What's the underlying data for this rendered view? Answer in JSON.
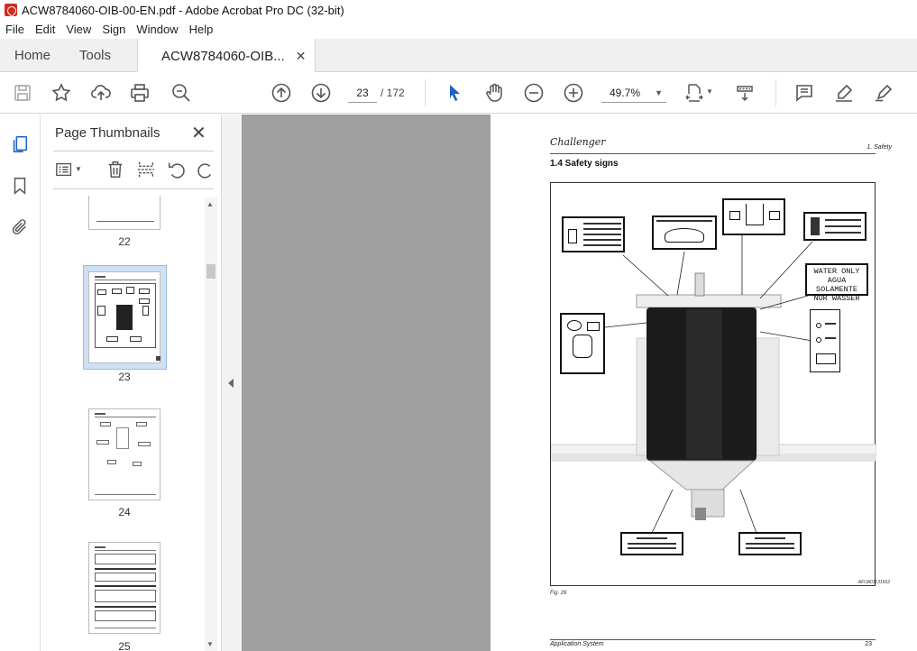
{
  "window": {
    "title": "ACW8784060-OIB-00-EN.pdf - Adobe Acrobat Pro DC (32-bit)"
  },
  "menu": [
    "File",
    "Edit",
    "View",
    "Sign",
    "Window",
    "Help"
  ],
  "tabs": {
    "home": "Home",
    "tools": "Tools",
    "doc": "ACW8784060-OIB..."
  },
  "nav": {
    "page_current": "23",
    "page_total": "/ 172",
    "zoom": "49.7%"
  },
  "panel": {
    "title": "Page Thumbnails",
    "thumbs": [
      {
        "label": "22"
      },
      {
        "label": "23"
      },
      {
        "label": "24"
      },
      {
        "label": "25"
      }
    ]
  },
  "page": {
    "brand": "Challenger",
    "section": "1. Safety",
    "heading": "1.4   Safety signs",
    "water_sign": [
      "WATER ONLY",
      "AGUA SOLAMENTE",
      "NUR WASSER"
    ],
    "figure_ref": "AFUA01131562",
    "figure_caption": "Fig. 26",
    "footer_left": "Application System",
    "footer_right": "23"
  },
  "icons": {
    "save": "save-icon",
    "star": "star-icon",
    "upload": "upload-icon",
    "print": "print-icon",
    "zoom_search": "zoom-search-icon",
    "page_up": "arrow-up-circle-icon",
    "page_down": "arrow-down-circle-icon",
    "select": "cursor-arrow-icon",
    "hand": "hand-icon",
    "zoom_out": "zoom-out-icon",
    "zoom_in": "zoom-in-icon"
  }
}
